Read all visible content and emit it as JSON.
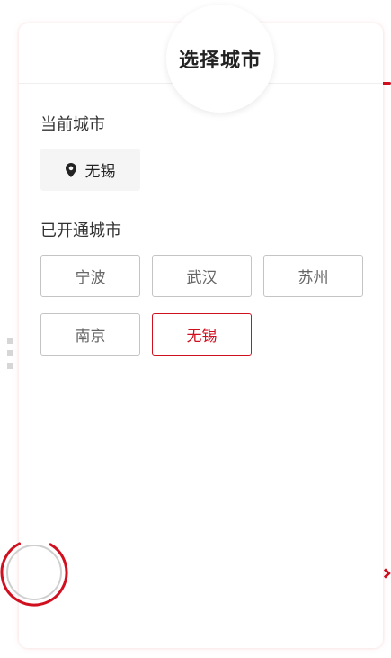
{
  "header": {
    "title": "选择城市"
  },
  "current": {
    "label": "当前城市",
    "city": "无锡",
    "icon": "location-pin-icon"
  },
  "opened": {
    "label": "已开通城市",
    "cities": [
      {
        "name": "宁波",
        "selected": false
      },
      {
        "name": "武汉",
        "selected": false
      },
      {
        "name": "苏州",
        "selected": false
      },
      {
        "name": "南京",
        "selected": false
      },
      {
        "name": "无锡",
        "selected": true
      }
    ]
  },
  "colors": {
    "accent": "#d0101f",
    "border": "#c4c4c4",
    "chip_bg": "#f5f5f5"
  }
}
